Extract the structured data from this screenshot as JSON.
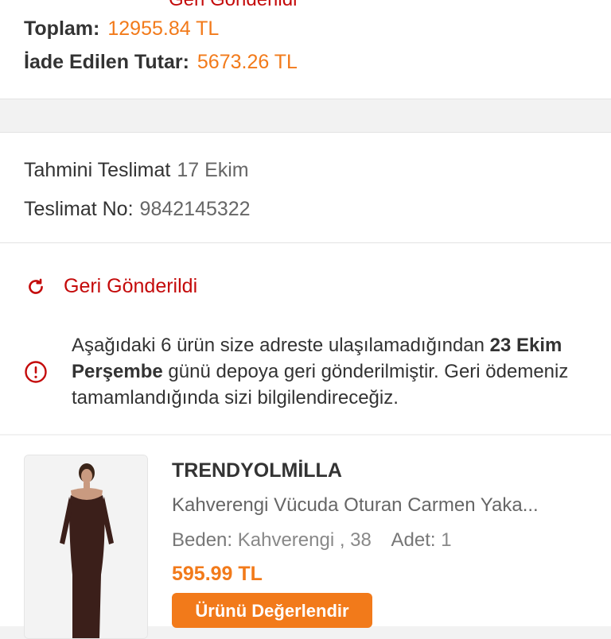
{
  "summary": {
    "status_cut": "Geri Gönderildi",
    "total_label": "Toplam:",
    "total_value": "12955.84 TL",
    "refund_label": "İade Edilen Tutar:",
    "refund_value": "5673.26 TL"
  },
  "delivery": {
    "estimated_label": "Tahmini Teslimat",
    "estimated_value": "17 Ekim",
    "number_label": "Teslimat No:",
    "number_value": "9842145322"
  },
  "shipment": {
    "status": "Geri Gönderildi",
    "info_part1": "Aşağıdaki 6 ürün size adreste ulaşılamadığından ",
    "info_bold": "23 Ekim Perşembe",
    "info_part2": " günü depoya geri gönderilmiştir. Geri ödemeniz tamamlandığında sizi bilgilendireceğiz."
  },
  "product": {
    "brand": "TRENDYOLMİLLA",
    "name": "Kahverengi Vücuda Oturan Carmen Yaka...",
    "size_label": "Beden:",
    "size_value": "Kahverengi , 38",
    "qty_label": "Adet:",
    "qty_value": "1",
    "price": "595.99 TL",
    "button_label": "Ürünü Değerlendir"
  },
  "colors": {
    "accent": "#f27a1a",
    "status_red": "#c40a0a"
  },
  "icons": [
    "refresh-icon",
    "info-icon"
  ]
}
